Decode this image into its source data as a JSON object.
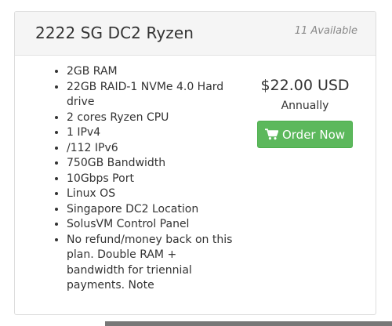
{
  "product": {
    "title": "2222 SG DC2 Ryzen",
    "availability": "11 Available",
    "features": [
      "2GB RAM",
      "22GB RAID-1 NVMe 4.0 Hard drive",
      "2 cores Ryzen CPU",
      "1 IPv4",
      "/112 IPv6",
      "750GB Bandwidth",
      "10Gbps Port",
      "Linux OS",
      "Singapore DC2 Location",
      "SolusVM Control Panel",
      "No refund/money back on this plan. Double RAM + bandwidth for triennial payments. Note"
    ],
    "price": "$22.00 USD",
    "billing_cycle": "Annually",
    "order_button_label": "Order Now",
    "order_button_icon": "shopping-cart-icon"
  },
  "colors": {
    "accent_green": "#5cb85c",
    "header_background": "#f5f5f5",
    "border": "#dddddd"
  }
}
